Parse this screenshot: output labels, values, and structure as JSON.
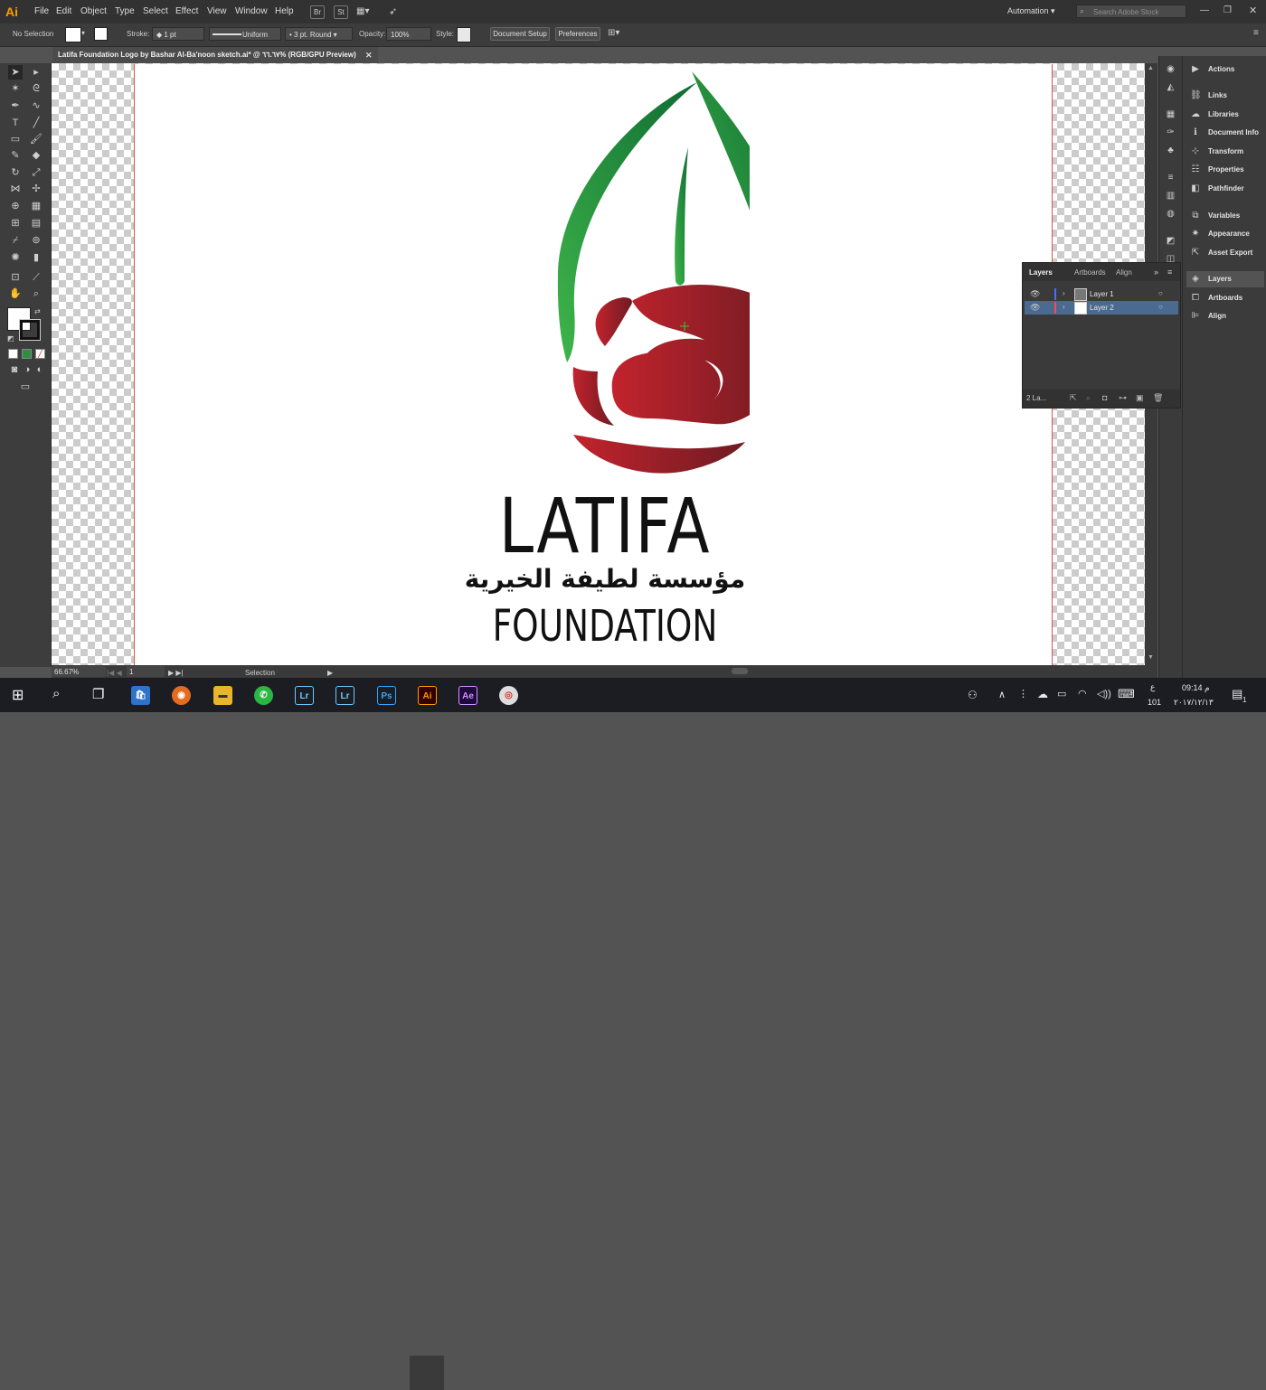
{
  "app": {
    "logo": "Ai",
    "color": "#ff9a00"
  },
  "menu": [
    "File",
    "Edit",
    "Object",
    "Type",
    "Select",
    "Effect",
    "View",
    "Window",
    "Help"
  ],
  "bridge": [
    "Br",
    "St"
  ],
  "workspace": "Automation",
  "search_placeholder": "Search Adobe Stock",
  "control": {
    "selection": "No Selection",
    "stroke_label": "Stroke:",
    "stroke_value": "1 pt",
    "profile": "Uniform",
    "brush": "3 pt. Round",
    "opacity_label": "Opacity:",
    "opacity_value": "100%",
    "style_label": "Style:",
    "doc_setup": "Document Setup",
    "preferences": "Preferences"
  },
  "document_tab": "Latifa Foundation Logo by Bashar Al-Ba'noon sketch.ai* @ ٦٦.٦٧% (RGB/GPU Preview)",
  "artwork": {
    "title_en": "LATIFA",
    "subtitle_ar": "مؤسسة لطيفة الخيرية",
    "subtitle_en": "FOUNDATION",
    "green": "#2ea043",
    "red": "#b3232e"
  },
  "status": {
    "zoom": "66.67%",
    "artboard": "1",
    "tool": "Selection"
  },
  "panels": [
    {
      "label": "Actions",
      "icon": "play-icon"
    },
    {
      "label": "Links",
      "icon": "link-icon"
    },
    {
      "label": "Libraries",
      "icon": "cloud-icon"
    },
    {
      "label": "Document Info",
      "icon": "info-icon"
    },
    {
      "label": "Transform",
      "icon": "transform-icon"
    },
    {
      "label": "Properties",
      "icon": "properties-icon"
    },
    {
      "label": "Pathfinder",
      "icon": "pathfinder-icon"
    },
    {
      "label": "Variables",
      "icon": "variables-icon"
    },
    {
      "label": "Appearance",
      "icon": "appearance-icon"
    },
    {
      "label": "Asset Export",
      "icon": "export-icon"
    },
    {
      "label": "Layers",
      "icon": "layers-icon"
    },
    {
      "label": "Artboards",
      "icon": "artboards-icon"
    },
    {
      "label": "Align",
      "icon": "align-icon"
    }
  ],
  "layers_panel": {
    "tabs": [
      "Layers",
      "Artboards",
      "Align"
    ],
    "rows": [
      {
        "name": "Layer 1",
        "color": "#4a6cff"
      },
      {
        "name": "Layer 2",
        "color": "#ff4a4a"
      }
    ],
    "count": "2 La..."
  },
  "taskbar": {
    "apps": [
      {
        "label": "Lr",
        "bg": "#0b2a3b",
        "fg": "#6ec6ff"
      },
      {
        "label": "Lr",
        "bg": "#0b2a3b",
        "fg": "#6ec6ff"
      },
      {
        "label": "Ps",
        "bg": "#0b1f33",
        "fg": "#31a8ff"
      },
      {
        "label": "Ai",
        "bg": "#330000",
        "fg": "#ff9a00"
      },
      {
        "label": "Ae",
        "bg": "#1f0a3d",
        "fg": "#d291ff"
      }
    ],
    "time": "09:14 م",
    "date": "٢٠١٧/١٢/١٣",
    "lang": "ع",
    "lang_num": "101",
    "notif": "1"
  }
}
